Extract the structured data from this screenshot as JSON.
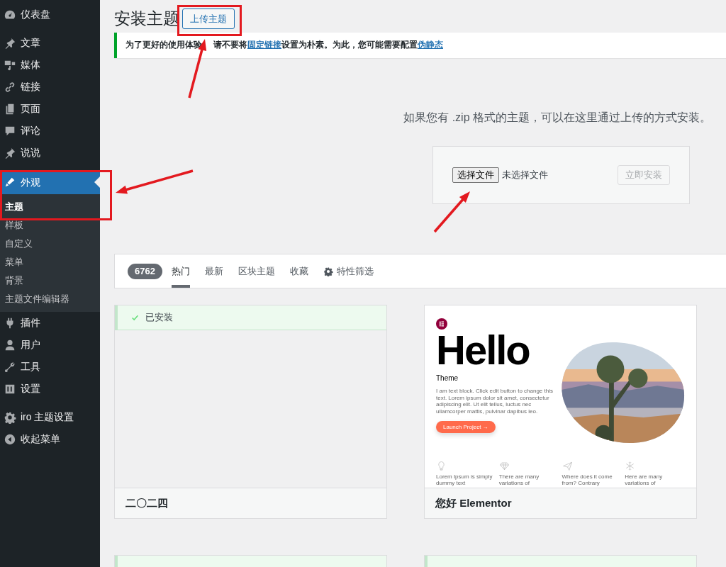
{
  "sidebar": {
    "groups": [
      [
        {
          "label": "仪表盘",
          "selected": false
        }
      ],
      [
        {
          "label": "文章",
          "selected": false
        },
        {
          "label": "媒体",
          "selected": false
        },
        {
          "label": "链接",
          "selected": false
        },
        {
          "label": "页面",
          "selected": false
        },
        {
          "label": "评论",
          "selected": false
        },
        {
          "label": "说说",
          "selected": false
        }
      ],
      [
        {
          "label": "外观",
          "selected": true,
          "children": [
            {
              "label": "主题",
              "selected": true
            },
            {
              "label": "样板",
              "selected": false
            },
            {
              "label": "自定义",
              "selected": false
            },
            {
              "label": "菜单",
              "selected": false
            },
            {
              "label": "背景",
              "selected": false
            },
            {
              "label": "主题文件编辑器",
              "selected": false
            }
          ]
        },
        {
          "label": "插件",
          "selected": false
        },
        {
          "label": "用户",
          "selected": false
        },
        {
          "label": "工具",
          "selected": false
        },
        {
          "label": "设置",
          "selected": false
        }
      ],
      [
        {
          "label": "iro 主题设置",
          "selected": false
        },
        {
          "label": "收起菜单",
          "selected": false
        }
      ]
    ]
  },
  "header": {
    "title": "安装主题",
    "upload_button": "上传主题"
  },
  "notice": {
    "parts": [
      {
        "kind": "text",
        "text": "为了更好的使用体验"
      },
      {
        "kind": "text",
        "text": "请不要将"
      },
      {
        "kind": "link",
        "text": "固定链接"
      },
      {
        "kind": "text",
        "text": "设置为朴素。为此，您可能需要配置"
      },
      {
        "kind": "link",
        "text": "伪静态"
      }
    ]
  },
  "upload": {
    "hint": "如果您有 .zip 格式的主题，可以在这里通过上传的方式安装。",
    "choose_button": "选择文件",
    "file_status": "未选择文件",
    "install_button": {
      "label": "立即安装",
      "disabled": true
    }
  },
  "filter_bar": {
    "count": "6762",
    "tabs": [
      {
        "label": "热门",
        "selected": true
      },
      {
        "label": "最新",
        "selected": false
      },
      {
        "label": "区块主题",
        "selected": false
      },
      {
        "label": "收藏",
        "selected": false
      }
    ],
    "feature_filter": "特性筛选"
  },
  "themes": [
    {
      "name": "二〇二四",
      "installed": true,
      "installed_label": "已安装",
      "preview": {
        "kind": "blank"
      }
    },
    {
      "name": "您好 Elementor",
      "installed": false,
      "preview": {
        "kind": "hello",
        "headline": "Hello",
        "subtitle": "Theme",
        "body": "I am text block. Click edit button to change this text. Lorem ipsum dolor sit amet, consectetur adipiscing elit. Ut elit tellus, luctus nec ullamcorper mattis, pulvinar dapibus leo.",
        "button": "Launch Project →",
        "features": [
          "Lorem Ipsum is simply dummy text",
          "There are many variations of",
          "Where does it come from? Contrary",
          "Here are many variations of"
        ]
      }
    },
    {
      "installed": true,
      "preview": {
        "kind": "blank"
      }
    },
    {
      "installed": true,
      "preview": {
        "kind": "blank"
      }
    }
  ]
}
